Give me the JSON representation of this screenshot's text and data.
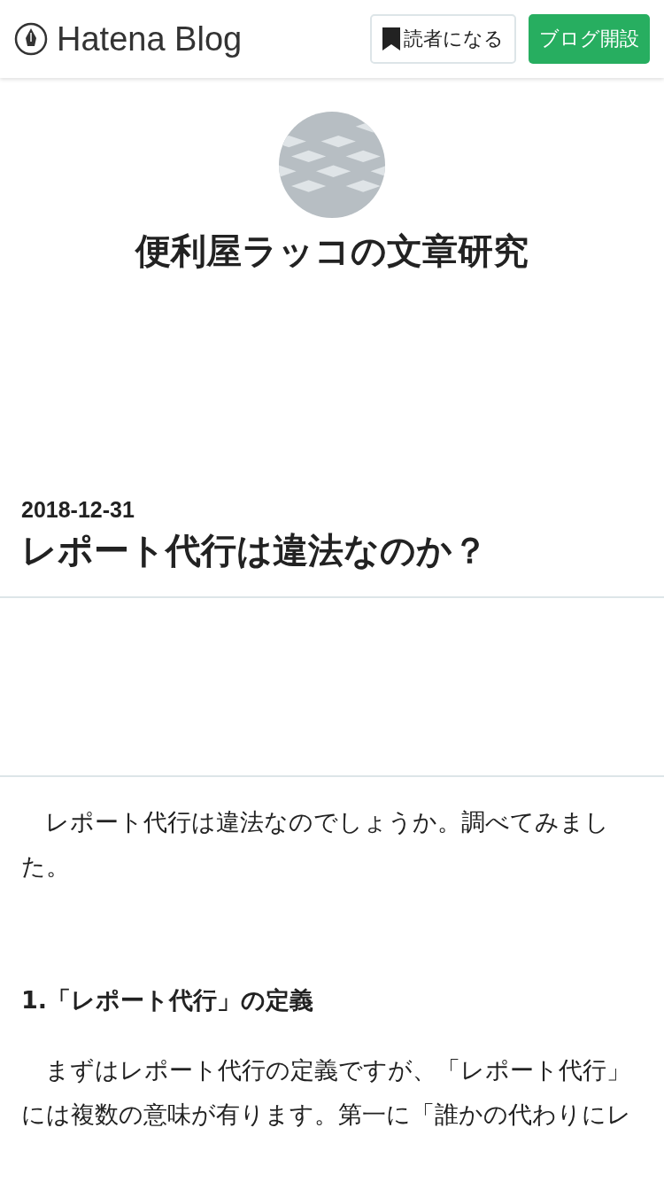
{
  "header": {
    "logo": "Hatena Blog",
    "buttons": [
      {
        "kind": "subscribe",
        "label": "読者になる"
      },
      {
        "kind": "create",
        "label": "ブログ開設"
      }
    ]
  },
  "blog": {
    "title": "便利屋ラッコの文章研究"
  },
  "entry": {
    "date": "2018-12-31",
    "title": "レポート代行は違法なのか？",
    "body": [
      {
        "kind": "paragraph",
        "text": "　レポート代行は違法なのでしょうか。調べてみました。"
      },
      {
        "kind": "heading",
        "text": "1.「レポート代行」の定義"
      },
      {
        "kind": "paragraph",
        "text": "　まずはレポート代行の定義ですが、「レポート代行」には複数の意味が有ります。第一に「誰かの代わりにレ"
      }
    ]
  }
}
